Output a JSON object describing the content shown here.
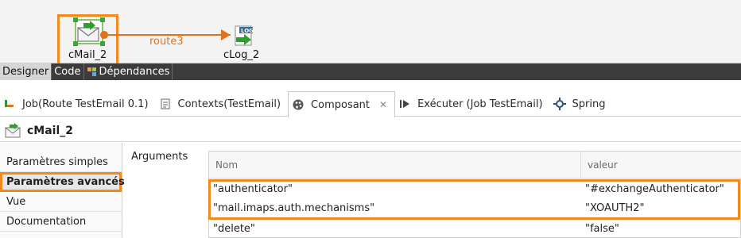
{
  "designer": {
    "components": [
      {
        "label": "cMail_2",
        "icon": "mail-icon",
        "selected": true
      },
      {
        "label": "cLog_2",
        "icon": "log-icon",
        "selected": false
      }
    ],
    "connection": {
      "label": "route3"
    },
    "colors": {
      "highlight": "#f08a1c",
      "route": "#e0731c",
      "handle": "#3aa63a"
    }
  },
  "editor_tabs": [
    {
      "label": "Designer",
      "active": true
    },
    {
      "label": "Code",
      "active": false
    },
    {
      "label": "Dépendances",
      "icon": "dependencies-icon",
      "active": false
    }
  ],
  "view_tabs": [
    {
      "label": "Job(Route TestEmail 0.1)",
      "icon": "route-icon"
    },
    {
      "label": "Contexts(TestEmail)",
      "icon": "contexts-icon"
    },
    {
      "label": "Composant",
      "icon": "palette-icon",
      "active": true,
      "close": "✕"
    },
    {
      "label": "Exécuter (Job TestEmail)",
      "icon": "run-icon"
    },
    {
      "label": "Spring",
      "icon": "spring-icon"
    }
  ],
  "component_header": {
    "title": "cMail_2",
    "icon": "mail-icon"
  },
  "side_nav": [
    {
      "label": "Paramètres simples",
      "selected": false
    },
    {
      "label": "Paramètres avancés",
      "selected": true
    },
    {
      "label": "Vue",
      "selected": false
    },
    {
      "label": "Documentation",
      "selected": false
    }
  ],
  "arguments": {
    "label": "Arguments",
    "columns": [
      "Nom",
      "valeur"
    ],
    "rows": [
      {
        "name": "\"authenticator\"",
        "value": "\"#exchangeAuthenticator\""
      },
      {
        "name": "\"mail.imaps.auth.mechanisms\"",
        "value": "\"XOAUTH2\""
      },
      {
        "name": "\"delete\"",
        "value": "\"false\""
      }
    ]
  }
}
